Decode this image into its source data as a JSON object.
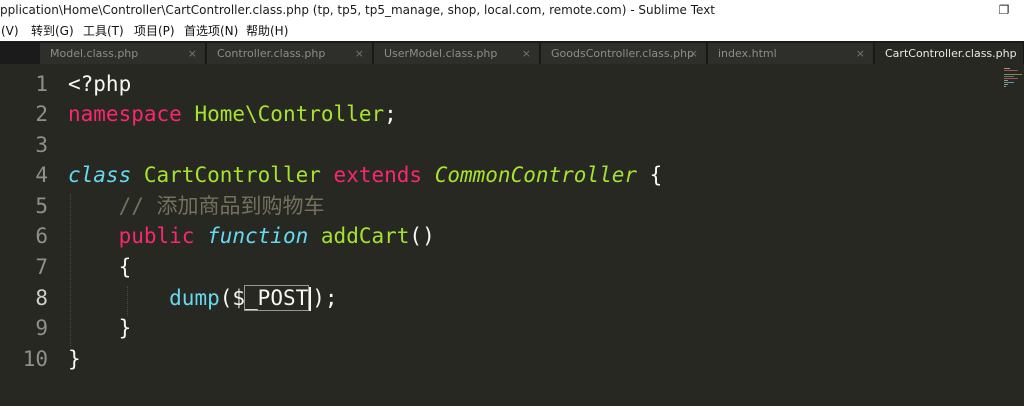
{
  "window": {
    "title": "pplication\\Home\\Controller\\CartController.class.php (tp, tp5, tp5_manage, shop, local.com, remote.com) - Sublime Text",
    "restore_glyph": "❐"
  },
  "menu": {
    "items": [
      "(V)",
      "转到(G)",
      "工具(T)",
      "项目(P)",
      "首选项(N)",
      "帮助(H)"
    ]
  },
  "tabs": [
    {
      "label": "Model.class.php",
      "active": false
    },
    {
      "label": "Controller.class.php",
      "active": false
    },
    {
      "label": "UserModel.class.php",
      "active": false
    },
    {
      "label": "GoodsController.class.php",
      "active": false
    },
    {
      "label": "index.html",
      "active": false
    },
    {
      "label": "CartController.class.php",
      "active": true
    }
  ],
  "tab_close_glyph": "×",
  "editor": {
    "line_numbers": [
      "1",
      "2",
      "3",
      "4",
      "5",
      "6",
      "7",
      "8",
      "9",
      "10"
    ],
    "current_line": 8,
    "code": {
      "l1_open": "<?php",
      "l2_namespace": "namespace",
      "l2_name": "Home\\Controller",
      "l2_semi": ";",
      "l4_class": "class",
      "l4_classname": "CartController",
      "l4_extends": "extends",
      "l4_parent": "CommonController",
      "l4_brace": "{",
      "l5_comment": "// 添加商品到购物车",
      "l6_public": "public",
      "l6_function": "function",
      "l6_name": "addCart",
      "l6_parens": "()",
      "l7_brace": "{",
      "l8_call": "dump",
      "l8_open": "($",
      "l8_var": "_POST",
      "l8_close": ");",
      "l9_brace": "}",
      "l10_brace": "}"
    }
  },
  "colors": {
    "background": "#272822",
    "keyword": "#f92672",
    "storage": "#66d9ef",
    "entity": "#a6e22e",
    "comment": "#75715e",
    "text": "#f8f8f2",
    "gutter_text": "#90908a"
  }
}
